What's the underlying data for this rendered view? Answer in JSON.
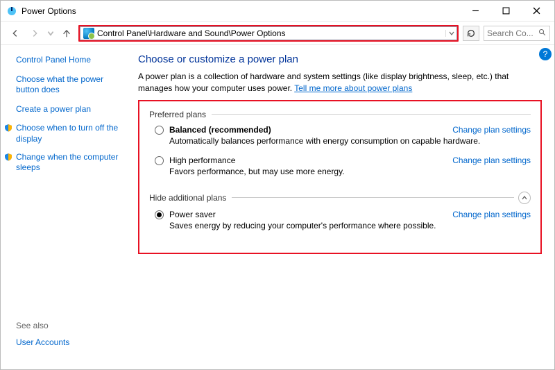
{
  "window": {
    "title": "Power Options"
  },
  "address": {
    "path": "Control Panel\\Hardware and Sound\\Power Options"
  },
  "search": {
    "placeholder": "Search Co..."
  },
  "sidebar": {
    "links": {
      "home": "Control Panel Home",
      "buttons": "Choose what the power button does",
      "create": "Create a power plan",
      "displayoff": "Choose when to turn off the display",
      "sleep": "Change when the computer sleeps"
    }
  },
  "see_also": {
    "header": "See also",
    "link": "User Accounts"
  },
  "main": {
    "title": "Choose or customize a power plan",
    "description": "A power plan is a collection of hardware and system settings (like display brightness, sleep, etc.) that manages how your computer uses power. ",
    "learn_more": "Tell me more about power plans",
    "preferred_label": "Preferred plans",
    "hide_label": "Hide additional plans",
    "change_link": "Change plan settings",
    "plans": {
      "balanced": {
        "title": "Balanced (recommended)",
        "sub": "Automatically balances performance with energy consumption on capable hardware."
      },
      "high": {
        "title": "High performance",
        "sub": "Favors performance, but may use more energy."
      },
      "saver": {
        "title": "Power saver",
        "sub": "Saves energy by reducing your computer's performance where possible."
      }
    }
  }
}
